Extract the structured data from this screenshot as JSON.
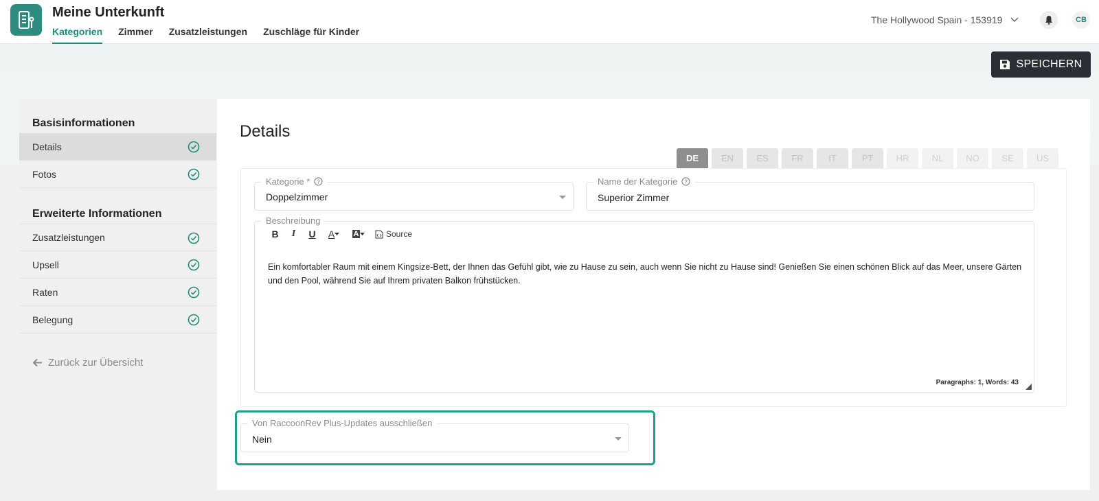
{
  "header": {
    "app_title": "Meine Unterkunft",
    "logo_icon": "building-icon",
    "nav": [
      {
        "label": "Kategorien",
        "active": true
      },
      {
        "label": "Zimmer",
        "active": false
      },
      {
        "label": "Zusatzleistungen",
        "active": false
      },
      {
        "label": "Zuschläge für Kinder",
        "active": false
      }
    ],
    "property": "The Hollywood Spain - 153919",
    "avatar_initials": "CB",
    "accent_color": "#1e8a7c"
  },
  "toolbar": {
    "save_label": "SPEICHERN",
    "save_color": "#2a2f36"
  },
  "sidebar": {
    "basic_heading": "Basisinformationen",
    "basic_items": [
      {
        "label": "Details",
        "active": true
      },
      {
        "label": "Fotos",
        "active": false
      }
    ],
    "extended_heading": "Erweiterte Informationen",
    "extended_items": [
      {
        "label": "Zusatzleistungen"
      },
      {
        "label": "Upsell"
      },
      {
        "label": "Raten"
      },
      {
        "label": "Belegung"
      }
    ],
    "back_label": "Zurück zur Übersicht"
  },
  "main": {
    "title": "Details",
    "languages": [
      "DE",
      "EN",
      "ES",
      "FR",
      "IT",
      "PT",
      "HR",
      "NL",
      "NO",
      "SE",
      "US"
    ],
    "active_language": "DE",
    "category": {
      "label": "Kategorie *",
      "value": "Doppelzimmer"
    },
    "category_name": {
      "label": "Name der Kategorie",
      "value": "Superior Zimmer"
    },
    "description": {
      "label": "Beschreibung",
      "toolbar": {
        "bold": "B",
        "italic": "I",
        "underline": "U",
        "font_color": "A",
        "bg_color": "A",
        "source": "Source"
      },
      "text": "Ein komfortabler Raum mit einem Kingsize-Bett, der Ihnen das Gefühl gibt, wie zu Hause zu sein, auch wenn Sie nicht zu Hause sind! Genießen Sie einen schönen Blick auf das Meer, unsere Gärten und den Pool, während Sie auf Ihrem privaten Balkon frühstücken.",
      "status": "Paragraphs: 1, Words: 43"
    },
    "exclude_updates": {
      "label": "Von RaccoonRev Plus-Updates ausschließen",
      "value": "Nein"
    },
    "highlight_color": "#1e9e8c"
  }
}
